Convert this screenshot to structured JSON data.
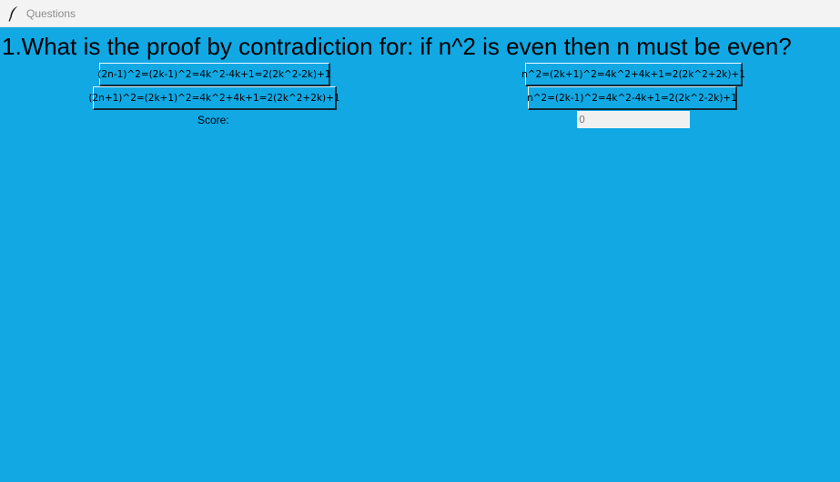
{
  "window": {
    "title": "Questions",
    "icon": "feather-icon"
  },
  "question": {
    "text": "1.What is the proof by contradiction for: if n^2 is even then n must be even?"
  },
  "answers": [
    {
      "label": "(2n-1)^2=(2k-1)^2=4k^2-4k+1=2(2k^2-2k)+1"
    },
    {
      "label": "n^2=(2k+1)^2=4k^2+4k+1=2(2k^2+2k)+1"
    },
    {
      "label": "(2n+1)^2=(2k+1)^2=4k^2+4k+1=2(2k^2+2k)+1"
    },
    {
      "label": "n^2=(2k-1)^2=4k^2-4k+1=2(2k^2-2k)+1"
    }
  ],
  "score": {
    "label": "Score:",
    "value": "0"
  },
  "colors": {
    "background": "#11a8e4",
    "titlebar": "#f3f3f3",
    "input_bg": "#f0f0f0"
  }
}
